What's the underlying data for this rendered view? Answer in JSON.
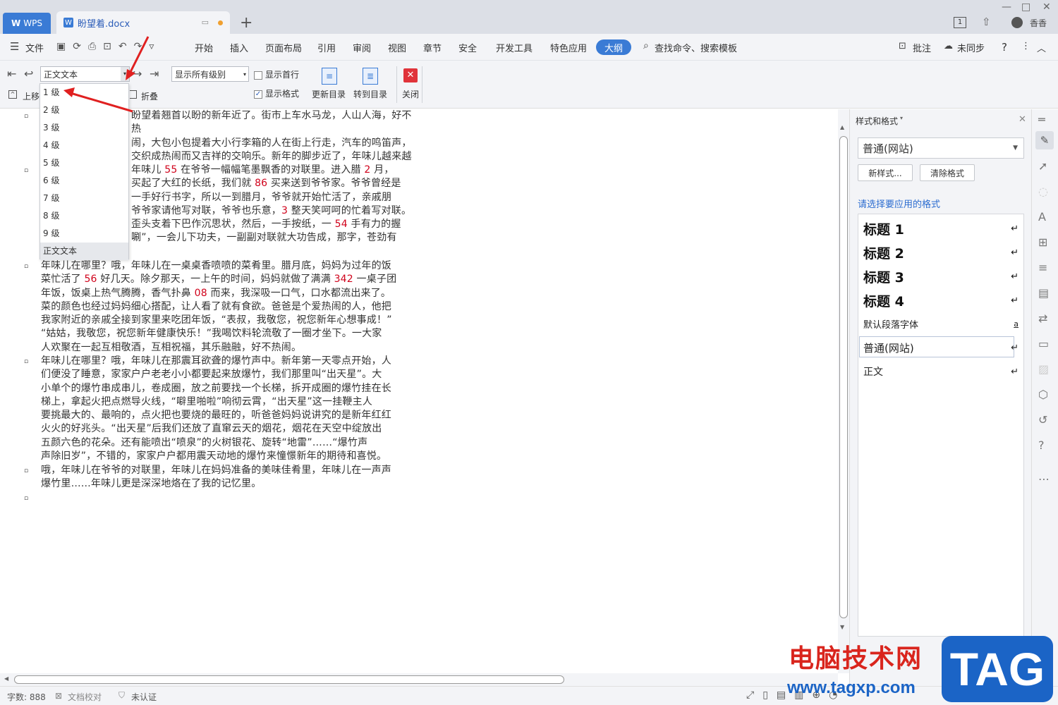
{
  "titlebar": {
    "wps_tab": "WPS",
    "doc_tab": "盼望着.docx",
    "user": "香香"
  },
  "menu": {
    "file": "文件",
    "items": [
      "开始",
      "插入",
      "页面布局",
      "引用",
      "审阅",
      "视图",
      "章节",
      "安全",
      "开发工具",
      "特色应用"
    ],
    "active": "大纲",
    "search": "查找命令、搜索模板",
    "comment": "批注",
    "sync": "未同步"
  },
  "toolbar": {
    "level_select": "正文文本",
    "show_levels": "显示所有级别",
    "show_first_line": "显示首行",
    "show_format": "显示格式",
    "update_toc": "更新目录",
    "goto_toc": "转到目录",
    "close": "关闭",
    "move_up": "上移",
    "collapse": "折叠"
  },
  "dropdown": {
    "items": [
      "1 级",
      "2 级",
      "3 级",
      "4 级",
      "5 级",
      "6 级",
      "7 级",
      "8 级",
      "9 级",
      "正文文本"
    ],
    "selected": "正文文本"
  },
  "document": {
    "p1": [
      "盼望着翘首以盼的新年近了。街市上车水马龙，人山人海，好不热",
      "闹，大包小包提着大小行李箱的人在街上行走，汽车的鸣笛声，商店的叫卖声，",
      "交织成热闹而又吉祥的交响乐。新年的脚步近了，年味儿越来越"
    ],
    "p2": [
      "年味儿在哪里？年味儿 55 在爷爷一幅幅笔墨飘香的对联里。进入腊 2 月，",
      "爷爷就买起了大红的长纸，我们就 86 买来送到爷爷家。爷爷曾经是",
      "老师，写一手好行书字，所以一到腊月，爷爷就开始忙活了，亲戚朋",
      "友都来爷爷家请他写对联，爷爷也乐意，3 整天笑呵呵的忙着写对联。",
      "爷爷歪着头支着下巴作沉思状，然后，一手按纸，一 54 手有力的握",
      "笔，“唰唰”，一会儿下功夫，一副副对联就大功告成，那字，苍劲有"
    ],
    "p3": [
      "年味儿在哪里？哦，年味儿在一桌桌香喷喷的菜肴里。腊月底，妈妈为过年的饭",
      "菜忙活了 56 好几天。除夕那天，一上午的时间，妈妈就做了满满 342 一桌子团",
      "年饭，饭桌上热气腾腾，香气扑鼻 08 而来，我深吸一口气，口水都流出来了。",
      "菜的颜色也经过妈妈细心搭配，让人看了就有食欲。爸爸是个爱热闹的人，他把",
      "我家附近的亲戚全接到家里来吃团年饭，“表叔，我敬您，祝您新年心想事成！”",
      "“姑姑，我敬您，祝您新年健康快乐！”我喝饮料轮流敬了一圈才坐下。一大家",
      "人欢聚在一起互相敬酒，互相祝福，其乐融融，好不热闹。"
    ],
    "p4": [
      "年味儿在哪里？哦，年味儿在那震耳欲聋的爆竹声中。新年第一天零点开始，人",
      "们便没了睡意，家家户户老老小小都要起来放爆竹，我们那里叫“出天星”。大",
      "小单个的爆竹串成串儿，卷成圈，放之前要找一个长梯，拆开成圈的爆竹挂在长",
      "梯上，拿起火把点燃导火线，“噼里啪啦”响彻云霄，“出天星”这一挂鞭主人",
      "要挑最大的、最响的，点火把也要烧的最旺的，听爸爸妈妈说讲究的是新年红红",
      "火火的好兆头。“出天星”后我们还放了直窜云天的烟花，烟花在天空中绽放出",
      "五颜六色的花朵。还有能喷出“喷泉”的火树银花、旋转“地雷”……“爆竹声",
      "声除旧岁”，不错的，家家户户都用震天动地的爆竹来憧憬新年的期待和喜悦。"
    ],
    "p5": [
      "哦，年味儿在爷爷的对联里，年味儿在妈妈准备的美味佳肴里，年味儿在一声声",
      "爆竹里……年味儿更是深深地烙在了我的记忆里。"
    ]
  },
  "panel": {
    "title": "样式和格式",
    "current_style": "普通(网站)",
    "new_style": "新样式...",
    "clear_format": "清除格式",
    "hint": "请选择要应用的格式",
    "styles": [
      {
        "name": "标题  1",
        "mark": "↵"
      },
      {
        "name": "标题  2",
        "mark": "↵"
      },
      {
        "name": "标题  3",
        "mark": "↵"
      },
      {
        "name": "标题  4",
        "mark": "↵"
      },
      {
        "name": "默认段落字体",
        "mark": "a"
      },
      {
        "name": "普通(网站)",
        "mark": "↵"
      },
      {
        "name": "正文",
        "mark": "↵"
      }
    ]
  },
  "status": {
    "word_count": "字数: 888",
    "proof": "文档校对",
    "auth": "未认证"
  },
  "watermark": {
    "text": "电脑技术网",
    "url": "www.tagxp.com",
    "tag": "TAG"
  },
  "colors": {
    "accent": "#3a7bd5",
    "red_numbers": "#d0021b",
    "watermark_red": "#d9251d",
    "watermark_blue": "#1b64c6"
  }
}
